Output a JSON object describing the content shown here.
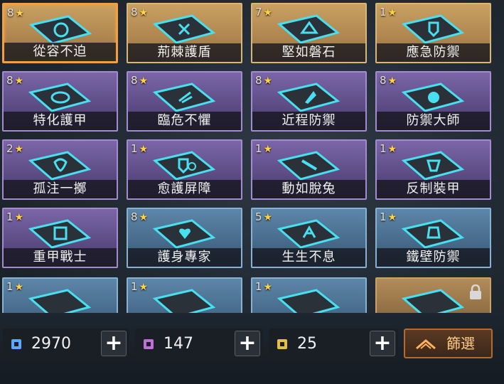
{
  "cards": [
    {
      "count": "8",
      "name": "從容不迫",
      "tier": "gold",
      "selected": true
    },
    {
      "count": "8",
      "name": "荊棘護盾",
      "tier": "gold"
    },
    {
      "count": "7",
      "name": "堅如磐石",
      "tier": "gold"
    },
    {
      "count": "1",
      "name": "應急防禦",
      "tier": "gold"
    },
    {
      "count": "8",
      "name": "特化護甲",
      "tier": "purple"
    },
    {
      "count": "8",
      "name": "臨危不懼",
      "tier": "purple"
    },
    {
      "count": "8",
      "name": "近程防禦",
      "tier": "purple"
    },
    {
      "count": "8",
      "name": "防禦大師",
      "tier": "purple"
    },
    {
      "count": "2",
      "name": "孤注一擲",
      "tier": "purple"
    },
    {
      "count": "1",
      "name": "愈護屏障",
      "tier": "purple"
    },
    {
      "count": "1",
      "name": "動如脫兔",
      "tier": "purple"
    },
    {
      "count": "1",
      "name": "反制裝甲",
      "tier": "purple"
    },
    {
      "count": "1",
      "name": "重甲戰士",
      "tier": "purple"
    },
    {
      "count": "8",
      "name": "護身專家",
      "tier": "blue"
    },
    {
      "count": "5",
      "name": "生生不息",
      "tier": "blue"
    },
    {
      "count": "1",
      "name": "鐵壁防禦",
      "tier": "blue"
    },
    {
      "count": "1",
      "name": "",
      "tier": "blue"
    },
    {
      "count": "1",
      "name": "",
      "tier": "blue"
    },
    {
      "count": "1",
      "name": "",
      "tier": "blue"
    },
    {
      "count": "",
      "name": "",
      "tier": "locked",
      "locked": true
    }
  ],
  "resources": {
    "blue_value": "2970",
    "purple_value": "147",
    "gold_value": "25",
    "plus_label": "+"
  },
  "filter": {
    "label": "篩選"
  },
  "colors": {
    "blue_res": "#5fa8ff",
    "purple_res": "#c070d8",
    "gold_res": "#e8c040",
    "accent": "#f0a040"
  }
}
